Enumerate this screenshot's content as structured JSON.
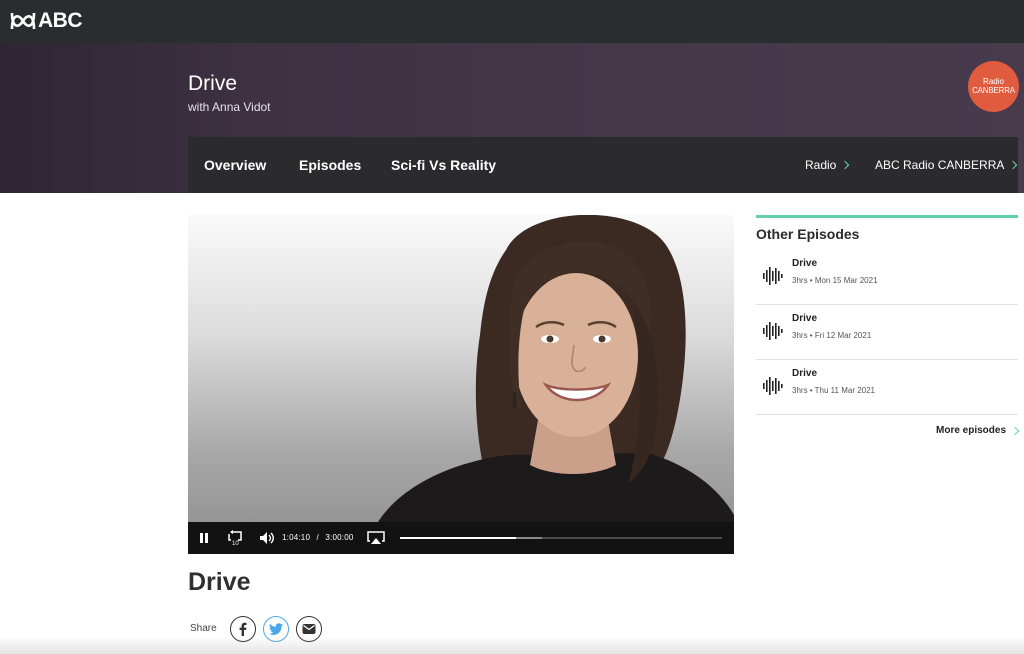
{
  "topbar": {
    "logo_text": "ABC"
  },
  "program": {
    "title": "Drive",
    "subtitle": "with Anna Vidot",
    "station_badge": {
      "line1": "Radio",
      "line2": "CANBERRA",
      "color": "#e15b3f"
    }
  },
  "nav": {
    "tabs": [
      {
        "label": "Overview"
      },
      {
        "label": "Episodes"
      },
      {
        "label": "Sci-fi Vs Reality"
      }
    ],
    "breadcrumbs": [
      {
        "label": "Radio"
      },
      {
        "label": "ABC Radio CANBERRA"
      }
    ]
  },
  "player": {
    "current_time": "1:04:10",
    "separator": "/",
    "duration": "3:00:00",
    "played_fraction": 0.36,
    "buffered_fraction": 0.44,
    "skip_back_seconds": "10"
  },
  "episode": {
    "title": "Drive"
  },
  "share": {
    "label": "Share"
  },
  "sidebar": {
    "heading": "Other Episodes",
    "accent_color": "#5fd1a7",
    "episodes": [
      {
        "name": "Drive",
        "duration": "3hrs",
        "date": "Mon 15 Mar 2021"
      },
      {
        "name": "Drive",
        "duration": "3hrs",
        "date": "Fri 12 Mar 2021"
      },
      {
        "name": "Drive",
        "duration": "3hrs",
        "date": "Thu 11 Mar 2021"
      }
    ],
    "more_label": "More episodes"
  }
}
